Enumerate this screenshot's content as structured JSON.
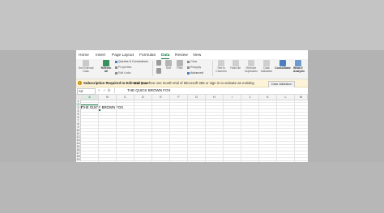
{
  "ribbon": {
    "tabs": [
      "Home",
      "Insert",
      "Page Layout",
      "Formulas",
      "Data",
      "Review",
      "View"
    ],
    "active_tab": "Data",
    "buttons": {
      "get_external_data": "Get External Data",
      "refresh_all": "Refresh All",
      "queries_connections": "Queries & Connections",
      "properties": "Properties",
      "edit_links": "Edit Links",
      "sort_asc": "",
      "sort_desc": "",
      "sort": "Sort",
      "filter": "Filter",
      "clear": "Clear",
      "reapply": "Reapply",
      "advanced": "Advanced",
      "text_to_columns": "Text to Columns",
      "flash_fill": "Flash-fill",
      "remove_duplicates": "Remove Duplicates",
      "data_validation": "Data Validation",
      "consolidate": "Consolidate",
      "what_if": "What-If Analysis"
    },
    "accent_color": "#107c41"
  },
  "message_bar": {
    "title": "Subscription Required to Edit and Save",
    "text": "Start your free one month trial of Microsoft 365 or sign in to activate an existing",
    "tooltip": "Data Validation"
  },
  "formula_bar": {
    "name_box": "A2",
    "cancel_icon": "×",
    "accept_icon": "✓",
    "fx_label": "fx",
    "content": "THE QUICK BROWN FOX"
  },
  "sheet": {
    "columns": [
      "A",
      "B",
      "C",
      "D",
      "E",
      "F",
      "G",
      "H",
      "I",
      "J",
      "K",
      "L",
      "M"
    ],
    "rows": [
      "1",
      "2",
      "3",
      "4",
      "5",
      "6",
      "7",
      "8",
      "9",
      "10",
      "11",
      "12",
      "13",
      "14",
      "15",
      "16",
      "17",
      "18",
      "19"
    ],
    "cell_a2": "THE QUICK BROWN FOX"
  }
}
